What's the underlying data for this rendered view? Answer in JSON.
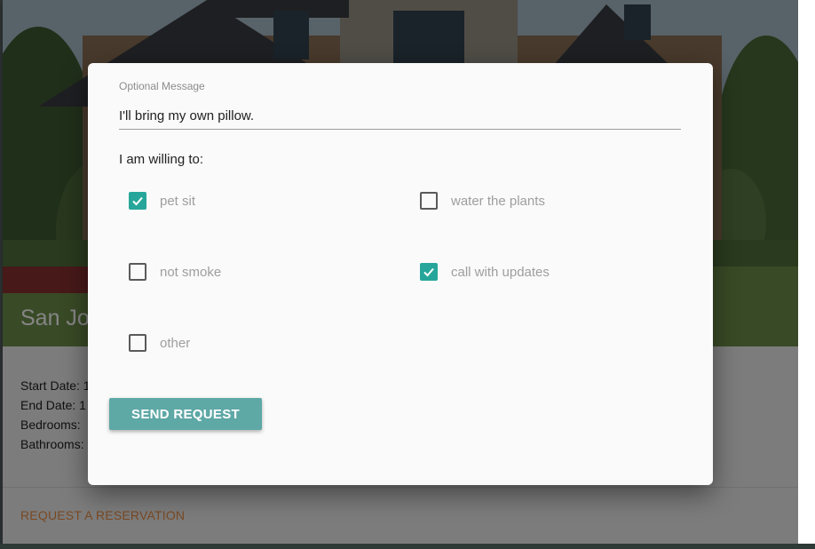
{
  "listing": {
    "title": "San Jos",
    "details": [
      "Start Date: 1",
      "End Date: 1",
      "Bedrooms:",
      "Bathrooms:"
    ],
    "action": "REQUEST A RESERVATION"
  },
  "dialog": {
    "message_label": "Optional Message",
    "message_value": "I'll bring my own pillow.",
    "willing_label": "I am willing to:",
    "options": [
      {
        "label": "pet sit",
        "checked": true
      },
      {
        "label": "water the plants",
        "checked": false
      },
      {
        "label": "not smoke",
        "checked": false
      },
      {
        "label": "call with updates",
        "checked": true
      },
      {
        "label": "other",
        "checked": false
      }
    ],
    "send_label": "SEND REQUEST"
  },
  "colors": {
    "accent": "#26a69a",
    "button": "#5ea8a6",
    "action_link": "#e98d43"
  },
  "icons": {
    "checkmark": "check-icon"
  }
}
